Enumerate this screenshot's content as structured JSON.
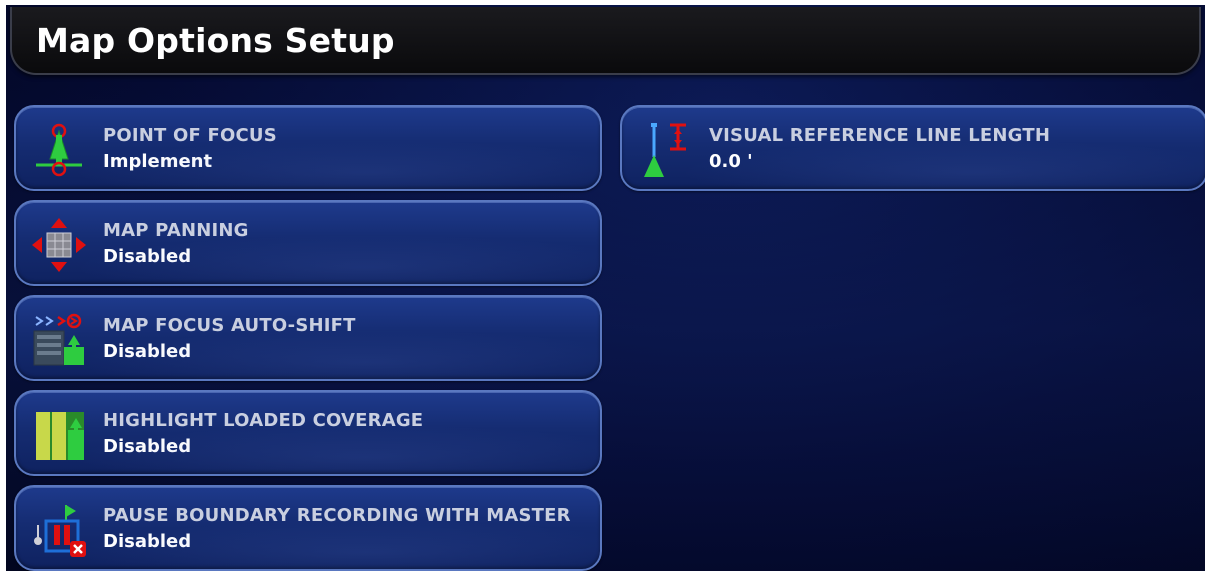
{
  "header": {
    "title": "Map Options Setup"
  },
  "options": [
    {
      "label": "POINT OF FOCUS",
      "value": "Implement",
      "icon": "point-of-focus-icon"
    },
    {
      "label": "MAP PANNING",
      "value": "Disabled",
      "icon": "map-panning-icon"
    },
    {
      "label": "MAP FOCUS AUTO-SHIFT",
      "value": "Disabled",
      "icon": "map-focus-auto-shift-icon"
    },
    {
      "label": "HIGHLIGHT LOADED COVERAGE",
      "value": "Disabled",
      "icon": "highlight-coverage-icon"
    },
    {
      "label": "PAUSE BOUNDARY RECORDING WITH MASTER",
      "value": "Disabled",
      "icon": "pause-boundary-icon"
    },
    {
      "label": "VISUAL REFERENCE LINE LENGTH",
      "value": "0.0 '",
      "icon": "reference-line-icon"
    }
  ],
  "colors": {
    "background": "#050b33",
    "button_fill": "#1a338a",
    "button_border": "#5a78c0",
    "label_text": "#c9cfe0",
    "value_text": "#ffffff",
    "accent_green": "#2ecc40",
    "accent_red": "#e01010"
  }
}
